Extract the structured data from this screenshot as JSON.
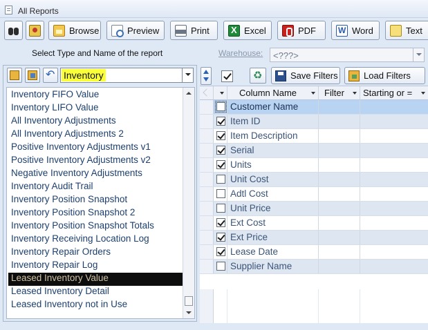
{
  "window": {
    "title": "All Reports"
  },
  "toolbar": {
    "browse": "Browse",
    "preview": "Preview",
    "print": "Print",
    "excel": "Excel",
    "pdf": "PDF",
    "word": "Word",
    "text": "Text"
  },
  "report_selector": {
    "label": "Select Type and Name of the report",
    "type_value": "Inventory",
    "reports": [
      "Inventory FIFO Value",
      "Inventory LIFO Value",
      "All Inventory Adjustments",
      "All Inventory Adjustments 2",
      "Positive Inventory Adjustments v1",
      "Positive Inventory Adjustments v2",
      "Negative Inventory Adjustments",
      "Inventory Audit Trail",
      "Inventory Position Snapshot",
      "Inventory Position Snapshot 2",
      "Inventory Position Snapshot Totals",
      "Inventory Receiving Location Log",
      "Inventory Repair Orders",
      "Inventory Repair Log",
      "Leased Inventory Value",
      "Leased Inventory Detail",
      "Leased Inventory not in Use"
    ],
    "selected_report": "Leased Inventory Value"
  },
  "warehouse": {
    "label": "Warehouse:",
    "value": "<???>"
  },
  "filters": {
    "save_label": "Save Filters",
    "load_label": "Load Filters",
    "columns": {
      "name": "Column Name",
      "filter": "Filter",
      "start": "Starting or ="
    },
    "rows": [
      {
        "name": "Customer Name",
        "checked": false
      },
      {
        "name": "Item ID",
        "checked": true
      },
      {
        "name": "Item Description",
        "checked": true
      },
      {
        "name": "Serial",
        "checked": true
      },
      {
        "name": "Units",
        "checked": true
      },
      {
        "name": "Unit Cost",
        "checked": false
      },
      {
        "name": "Adtl Cost",
        "checked": false
      },
      {
        "name": "Unit Price",
        "checked": false
      },
      {
        "name": "Ext Cost",
        "checked": true
      },
      {
        "name": "Ext Price",
        "checked": true
      },
      {
        "name": "Lease Date",
        "checked": true
      },
      {
        "name": "Supplier Name",
        "checked": false
      }
    ]
  },
  "colors": {
    "accent": "#b9d3f2",
    "highlight": "#fbff3a",
    "selected_row": "#0d0d0d"
  }
}
